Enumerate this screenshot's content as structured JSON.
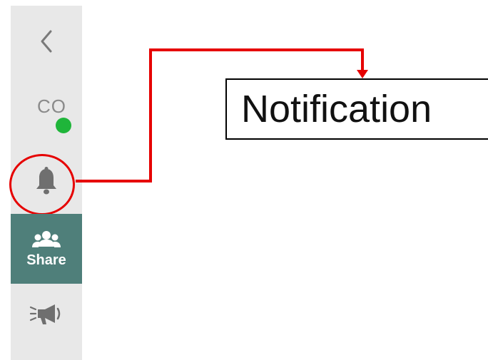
{
  "sidebar": {
    "back_icon": "chevron-left-icon",
    "avatar": {
      "initials": "CO",
      "status": "online",
      "status_color": "#1fb53a"
    },
    "notification_icon": "bell-icon",
    "share": {
      "icon": "people-icon",
      "label": "Share",
      "active_color": "#4f7f7a"
    },
    "announce_icon": "megaphone-icon"
  },
  "callout": {
    "text": "Notification",
    "highlight_color": "#e60000"
  }
}
